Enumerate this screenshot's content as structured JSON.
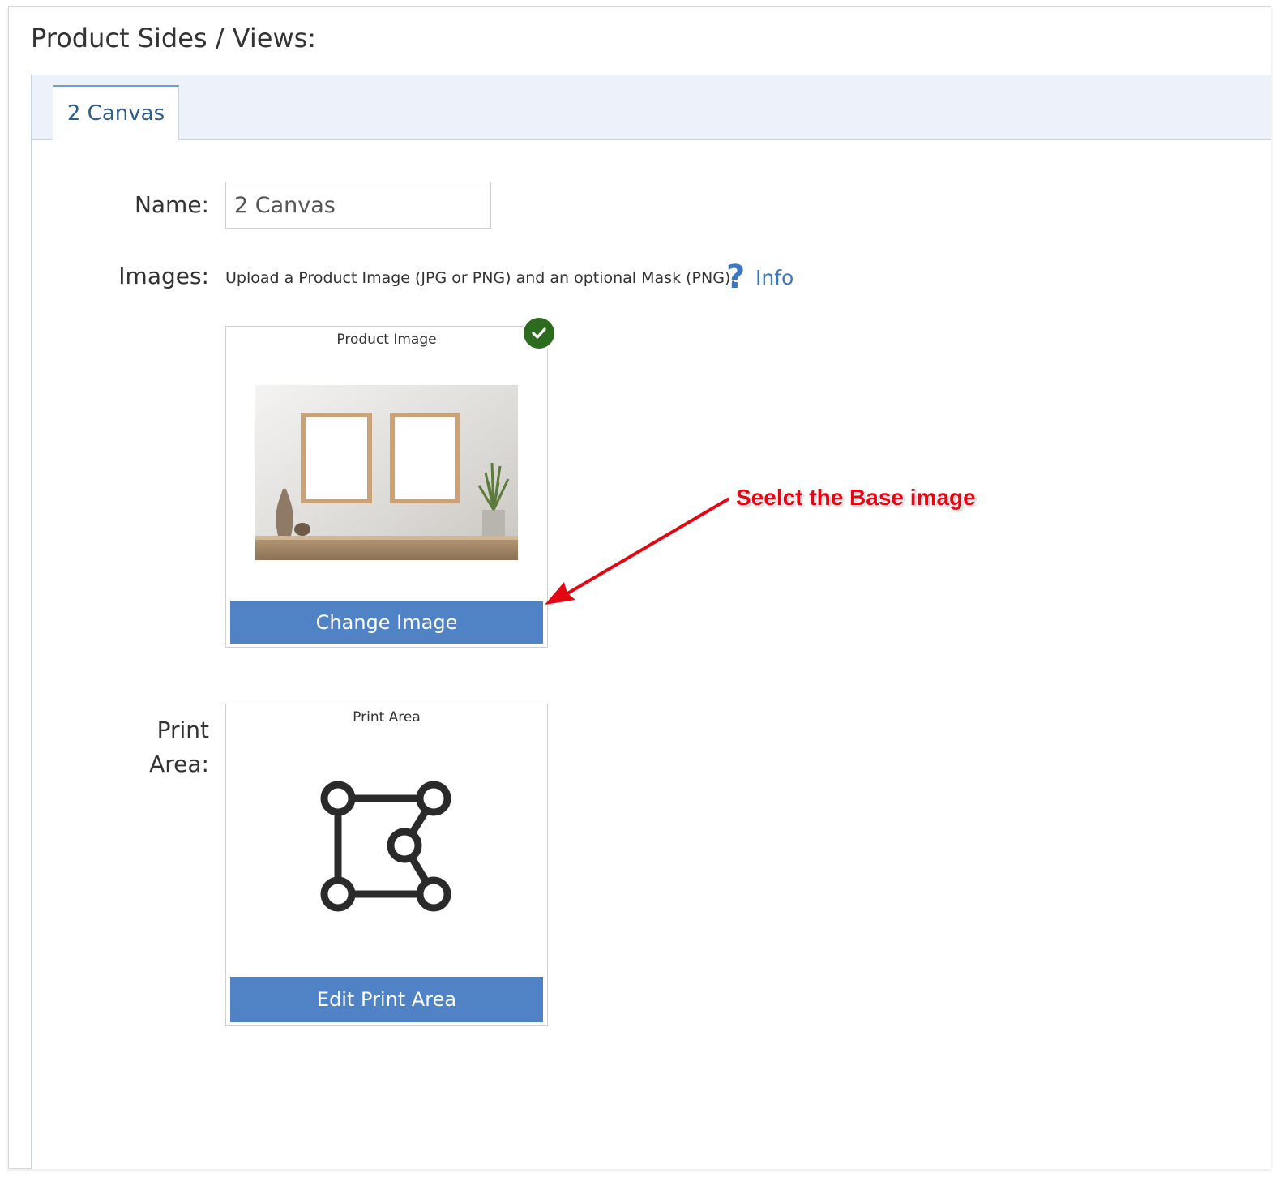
{
  "page": {
    "title": "Product Sides / Views:"
  },
  "tabs": [
    {
      "label": "2 Canvas",
      "active": true
    }
  ],
  "form": {
    "name_label": "Name:",
    "name_value": "2 Canvas",
    "images_label": "Images:",
    "upload_instructions": "Upload a Product Image (JPG or PNG) and an optional Mask (PNG).",
    "help_icon": "?",
    "info_link": "Info",
    "print_area_label_line1": "Print",
    "print_area_label_line2": "Area:"
  },
  "product_image_card": {
    "title": "Product Image",
    "button_label": "Change Image",
    "status_icon": "check-icon",
    "status_color": "#2d6b1f",
    "image_alt": "two empty wooden frames on a wall above a shelf with vases and a plant"
  },
  "print_area_card": {
    "title": "Print Area",
    "button_label": "Edit Print Area",
    "icon": "print-area-shape-icon"
  },
  "annotation": {
    "text": "Seelct the Base image",
    "color": "#e30613"
  },
  "colors": {
    "accent_button": "#5082c6",
    "link": "#3c78c2",
    "tab_text": "#2f5d8a",
    "tabbar_bg": "#edf1f9"
  }
}
